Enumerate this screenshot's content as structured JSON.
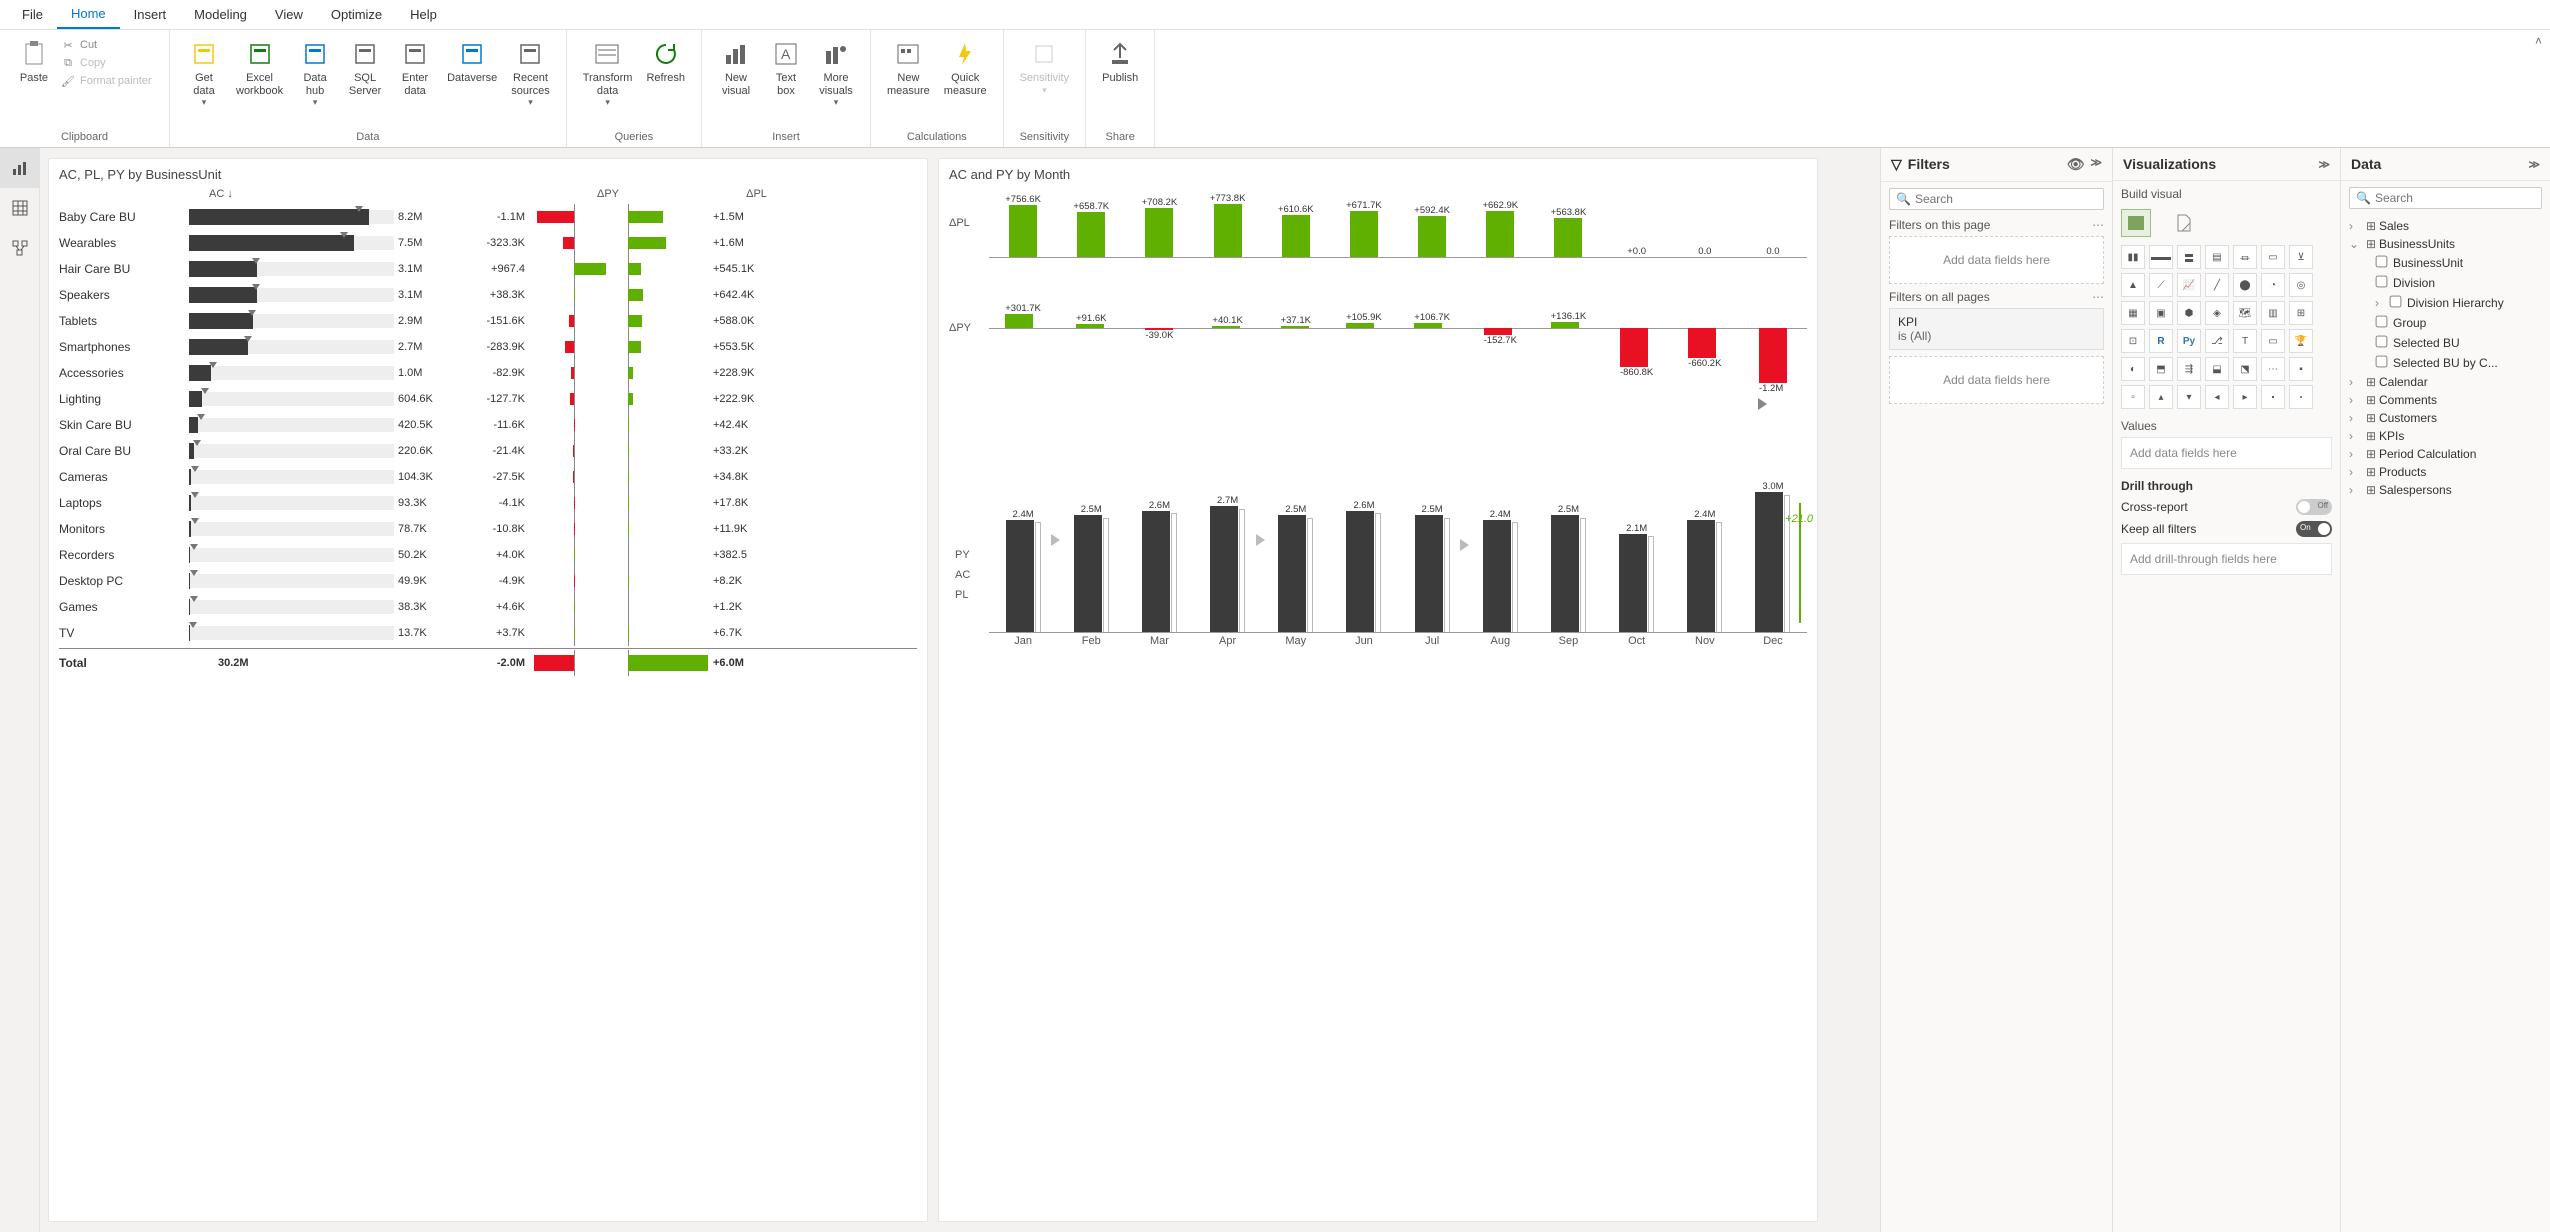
{
  "menu": {
    "items": [
      "File",
      "Home",
      "Insert",
      "Modeling",
      "View",
      "Optimize",
      "Help"
    ],
    "active": 1
  },
  "ribbon": {
    "clipboard": {
      "paste": "Paste",
      "cut": "Cut",
      "copy": "Copy",
      "fmt": "Format painter",
      "label": "Clipboard"
    },
    "data": {
      "get": "Get\ndata",
      "excel": "Excel\nworkbook",
      "hub": "Data\nhub",
      "sql": "SQL\nServer",
      "enter": "Enter\ndata",
      "dv": "Dataverse",
      "recent": "Recent\nsources",
      "label": "Data"
    },
    "queries": {
      "transform": "Transform\ndata",
      "refresh": "Refresh",
      "label": "Queries"
    },
    "insert": {
      "newvis": "New\nvisual",
      "textbox": "Text\nbox",
      "more": "More\nvisuals",
      "label": "Insert"
    },
    "calc": {
      "newm": "New\nmeasure",
      "quick": "Quick\nmeasure",
      "label": "Calculations"
    },
    "sens": {
      "btn": "Sensitivity",
      "label": "Sensitivity"
    },
    "share": {
      "btn": "Publish",
      "label": "Share"
    }
  },
  "left_chart": {
    "title": "AC, PL, PY by BusinessUnit",
    "col_ac": "AC ↓",
    "col_dpy": "ΔPY",
    "col_dpl": "ΔPL",
    "rows": [
      {
        "name": "Baby Care BU",
        "ac": 8.2,
        "ac_label": "8.2M",
        "dpy": -1.1,
        "dpy_label": "-1.1M",
        "dpl": 1.5,
        "dpl_label": "+1.5M"
      },
      {
        "name": "Wearables",
        "ac": 7.5,
        "ac_label": "7.5M",
        "dpy": -0.3233,
        "dpy_label": "-323.3K",
        "dpl": 1.6,
        "dpl_label": "+1.6M"
      },
      {
        "name": "Hair Care BU",
        "ac": 3.1,
        "ac_label": "3.1M",
        "dpy": 0.9674,
        "dpy_label": "+967.4",
        "dpl": 0.5451,
        "dpl_label": "+545.1K"
      },
      {
        "name": "Speakers",
        "ac": 3.1,
        "ac_label": "3.1M",
        "dpy": 0.0383,
        "dpy_label": "+38.3K",
        "dpl": 0.6424,
        "dpl_label": "+642.4K"
      },
      {
        "name": "Tablets",
        "ac": 2.9,
        "ac_label": "2.9M",
        "dpy": -0.1516,
        "dpy_label": "-151.6K",
        "dpl": 0.588,
        "dpl_label": "+588.0K"
      },
      {
        "name": "Smartphones",
        "ac": 2.7,
        "ac_label": "2.7M",
        "dpy": -0.2839,
        "dpy_label": "-283.9K",
        "dpl": 0.5535,
        "dpl_label": "+553.5K"
      },
      {
        "name": "Accessories",
        "ac": 1.0,
        "ac_label": "1.0M",
        "dpy": -0.0829,
        "dpy_label": "-82.9K",
        "dpl": 0.2289,
        "dpl_label": "+228.9K"
      },
      {
        "name": "Lighting",
        "ac": 0.6046,
        "ac_label": "604.6K",
        "dpy": -0.1277,
        "dpy_label": "-127.7K",
        "dpl": 0.2229,
        "dpl_label": "+222.9K"
      },
      {
        "name": "Skin Care BU",
        "ac": 0.4205,
        "ac_label": "420.5K",
        "dpy": -0.0116,
        "dpy_label": "-11.6K",
        "dpl": 0.0424,
        "dpl_label": "+42.4K"
      },
      {
        "name": "Oral Care BU",
        "ac": 0.2206,
        "ac_label": "220.6K",
        "dpy": -0.0214,
        "dpy_label": "-21.4K",
        "dpl": 0.0332,
        "dpl_label": "+33.2K"
      },
      {
        "name": "Cameras",
        "ac": 0.1043,
        "ac_label": "104.3K",
        "dpy": -0.0275,
        "dpy_label": "-27.5K",
        "dpl": 0.0348,
        "dpl_label": "+34.8K"
      },
      {
        "name": "Laptops",
        "ac": 0.0933,
        "ac_label": "93.3K",
        "dpy": -0.0041,
        "dpy_label": "-4.1K",
        "dpl": 0.0178,
        "dpl_label": "+17.8K"
      },
      {
        "name": "Monitors",
        "ac": 0.0787,
        "ac_label": "78.7K",
        "dpy": -0.0108,
        "dpy_label": "-10.8K",
        "dpl": 0.0119,
        "dpl_label": "+11.9K"
      },
      {
        "name": "Recorders",
        "ac": 0.0502,
        "ac_label": "50.2K",
        "dpy": 0.004,
        "dpy_label": "+4.0K",
        "dpl": 0.0004,
        "dpl_label": "+382.5"
      },
      {
        "name": "Desktop PC",
        "ac": 0.0499,
        "ac_label": "49.9K",
        "dpy": -0.0049,
        "dpy_label": "-4.9K",
        "dpl": 0.0082,
        "dpl_label": "+8.2K"
      },
      {
        "name": "Games",
        "ac": 0.0383,
        "ac_label": "38.3K",
        "dpy": 0.0046,
        "dpy_label": "+4.6K",
        "dpl": 0.0012,
        "dpl_label": "+1.2K"
      },
      {
        "name": "TV",
        "ac": 0.0137,
        "ac_label": "13.7K",
        "dpy": 0.0037,
        "dpy_label": "+3.7K",
        "dpl": 0.0067,
        "dpl_label": "+6.7K"
      }
    ],
    "total": {
      "name": "Total",
      "ac_label": "30.2M",
      "dpy": -2.0,
      "dpy_label": "-2.0M",
      "dpl": 6.0,
      "dpl_label": "+6.0M"
    },
    "ac_max": 8.2,
    "dpy_max": 1.2,
    "dpl_max": 1.7
  },
  "right_chart": {
    "title": "AC and PY by Month",
    "months": [
      "Jan",
      "Feb",
      "Mar",
      "Apr",
      "May",
      "Jun",
      "Jul",
      "Aug",
      "Sep",
      "Oct",
      "Nov",
      "Dec"
    ],
    "dpl": [
      {
        "v": 756.6,
        "label": "+756.6K"
      },
      {
        "v": 658.7,
        "label": "+658.7K"
      },
      {
        "v": 708.2,
        "label": "+708.2K"
      },
      {
        "v": 773.8,
        "label": "+773.8K"
      },
      {
        "v": 610.6,
        "label": "+610.6K"
      },
      {
        "v": 671.7,
        "label": "+671.7K"
      },
      {
        "v": 592.4,
        "label": "+592.4K"
      },
      {
        "v": 662.9,
        "label": "+662.9K"
      },
      {
        "v": 563.8,
        "label": "+563.8K"
      },
      {
        "v": 0,
        "label": "+0.0"
      },
      {
        "v": 0,
        "label": "0.0"
      },
      {
        "v": 0,
        "label": "0.0"
      }
    ],
    "dpy": [
      {
        "v": 301.7,
        "label": "+301.7K"
      },
      {
        "v": 91.6,
        "label": "+91.6K"
      },
      {
        "v": -39.0,
        "label": "-39.0K"
      },
      {
        "v": 40.1,
        "label": "+40.1K"
      },
      {
        "v": 37.1,
        "label": "+37.1K"
      },
      {
        "v": 105.9,
        "label": "+105.9K"
      },
      {
        "v": 106.7,
        "label": "+106.7K"
      },
      {
        "v": -152.7,
        "label": "-152.7K"
      },
      {
        "v": 136.1,
        "label": "+136.1K"
      },
      {
        "v": -860.8,
        "label": "-860.8K"
      },
      {
        "v": -660.2,
        "label": "-660.2K"
      },
      {
        "v": -1200,
        "label": "-1.2M"
      }
    ],
    "py": [
      {
        "v": 2.4,
        "label": "2.4M"
      },
      {
        "v": 2.5,
        "label": "2.5M"
      },
      {
        "v": 2.6,
        "label": "2.6M"
      },
      {
        "v": 2.7,
        "label": "2.7M"
      },
      {
        "v": 2.5,
        "label": "2.5M"
      },
      {
        "v": 2.6,
        "label": "2.6M"
      },
      {
        "v": 2.5,
        "label": "2.5M"
      },
      {
        "v": 2.4,
        "label": "2.4M"
      },
      {
        "v": 2.5,
        "label": "2.5M"
      },
      {
        "v": 2.1,
        "label": "2.1M"
      },
      {
        "v": 2.4,
        "label": "2.4M"
      },
      {
        "v": 3.0,
        "label": "3.0M"
      }
    ],
    "py_max": 3.0,
    "dpl_max": 800,
    "dpy_abs_max": 1200,
    "delta_label": "+21.0",
    "legend": {
      "py": "PY",
      "ac": "AC",
      "pl": "PL"
    },
    "axis_dpl": "ΔPL",
    "axis_dpy": "ΔPY"
  },
  "filters_panel": {
    "title": "Filters",
    "search": "Search",
    "on_page": "Filters on this page",
    "on_all": "Filters on all pages",
    "add_fields": "Add data fields here",
    "kpi_title": "KPI",
    "kpi_val": "is (All)"
  },
  "viz_panel": {
    "title": "Visualizations",
    "build": "Build visual",
    "values": "Values",
    "add_fields": "Add data fields here",
    "drill": "Drill through",
    "cross": "Cross-report",
    "keep": "Keep all filters",
    "drill_well": "Add drill-through fields here",
    "off": "Off",
    "on": "On"
  },
  "data_panel": {
    "title": "Data",
    "search": "Search",
    "tables": [
      {
        "name": "Sales",
        "expanded": false
      },
      {
        "name": "BusinessUnits",
        "expanded": true,
        "fields": [
          "BusinessUnit",
          "Division",
          "Division Hierarchy",
          "Group",
          "Selected BU",
          "Selected BU by C..."
        ]
      },
      {
        "name": "Calendar",
        "expanded": false
      },
      {
        "name": "Comments",
        "expanded": false
      },
      {
        "name": "Customers",
        "expanded": false
      },
      {
        "name": "KPIs",
        "expanded": false
      },
      {
        "name": "Period Calculation",
        "expanded": false
      },
      {
        "name": "Products",
        "expanded": false
      },
      {
        "name": "Salespersons",
        "expanded": false
      }
    ]
  },
  "chart_data": [
    {
      "type": "bar",
      "orientation": "horizontal",
      "title": "AC, PL, PY by BusinessUnit",
      "categories": [
        "Baby Care BU",
        "Wearables",
        "Hair Care BU",
        "Speakers",
        "Tablets",
        "Smartphones",
        "Accessories",
        "Lighting",
        "Skin Care BU",
        "Oral Care BU",
        "Cameras",
        "Laptops",
        "Monitors",
        "Recorders",
        "Desktop PC",
        "Games",
        "TV"
      ],
      "series": [
        {
          "name": "AC (M)",
          "values": [
            8.2,
            7.5,
            3.1,
            3.1,
            2.9,
            2.7,
            1.0,
            0.6046,
            0.4205,
            0.2206,
            0.1043,
            0.0933,
            0.0787,
            0.0502,
            0.0499,
            0.0383,
            0.0137
          ]
        },
        {
          "name": "ΔPY (K)",
          "values": [
            -1100,
            -323.3,
            0.9674,
            38.3,
            -151.6,
            -283.9,
            -82.9,
            -127.7,
            -11.6,
            -21.4,
            -27.5,
            -4.1,
            -10.8,
            4.0,
            -4.9,
            4.6,
            3.7
          ]
        },
        {
          "name": "ΔPL (K)",
          "values": [
            1500,
            1600,
            545.1,
            642.4,
            588.0,
            553.5,
            228.9,
            222.9,
            42.4,
            33.2,
            34.8,
            17.8,
            11.9,
            0.3825,
            8.2,
            1.2,
            6.7
          ]
        }
      ],
      "totals": {
        "AC": "30.2M",
        "ΔPY": "-2.0M",
        "ΔPL": "+6.0M"
      }
    },
    {
      "type": "bar",
      "title": "AC and PY by Month",
      "categories": [
        "Jan",
        "Feb",
        "Mar",
        "Apr",
        "May",
        "Jun",
        "Jul",
        "Aug",
        "Sep",
        "Oct",
        "Nov",
        "Dec"
      ],
      "series": [
        {
          "name": "ΔPL (K)",
          "values": [
            756.6,
            658.7,
            708.2,
            773.8,
            610.6,
            671.7,
            592.4,
            662.9,
            563.8,
            0,
            0,
            0
          ]
        },
        {
          "name": "ΔPY (K)",
          "values": [
            301.7,
            91.6,
            -39.0,
            40.1,
            37.1,
            105.9,
            106.7,
            -152.7,
            136.1,
            -860.8,
            -660.2,
            -1200
          ]
        },
        {
          "name": "PY/AC (M)",
          "values": [
            2.4,
            2.5,
            2.6,
            2.7,
            2.5,
            2.6,
            2.5,
            2.4,
            2.5,
            2.1,
            2.4,
            3.0
          ]
        }
      ],
      "annotations": [
        "+21.0"
      ]
    }
  ]
}
